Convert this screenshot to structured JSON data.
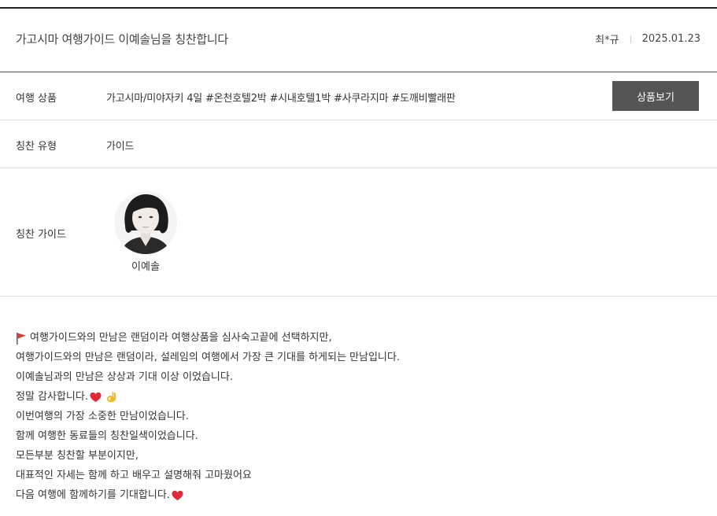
{
  "post": {
    "title": "가고시마 여행가이드 이예솔님을 칭찬합니다",
    "author": "최*규",
    "date": "2025.01.23"
  },
  "details": {
    "product_label": "여행 상품",
    "product_value": "가고시마/미야자키 4일 #온천호텔2박 #시내호텔1박 #사쿠라지마 #도깨비빨래판",
    "product_button": "상품보기",
    "type_label": "칭찬 유형",
    "type_value": "가이드",
    "guide_label": "칭찬 가이드",
    "guide_name": "이예솔"
  },
  "body": {
    "lines": [
      "여행가이드와의 만남은 랜덤이라 여행상품을 심사숙고끝에 선택하지만,",
      "여행가이드와의 만남은 랜덤이라, 설레임의 여행에서 가장 큰 기대를 하게되는 만남입니다.",
      "이예솔님과의 만남은 상상과 기대 이상 이었습니다.",
      "정말 감사합니다.",
      "이번여행의 가장 소중한 만남이었습니다.",
      "함께 여행한 동료들의 칭찬일색이었습니다.",
      "모든부분 칭찬할 부분이지만,",
      "대표적인 자세는 함께 하고 배우고 설명해줘 고마웠어요",
      "다음 여행에 함께하기를 기대합니다."
    ]
  },
  "icons": {
    "flag": "red-flag-icon",
    "heart": "red-heart-icon",
    "ok_hand": "ok-hand-icon"
  },
  "colors": {
    "button_bg": "#555555",
    "flag": "#e03a2e",
    "heart": "#e02a3a",
    "ok_hand": "#f5b92e"
  }
}
